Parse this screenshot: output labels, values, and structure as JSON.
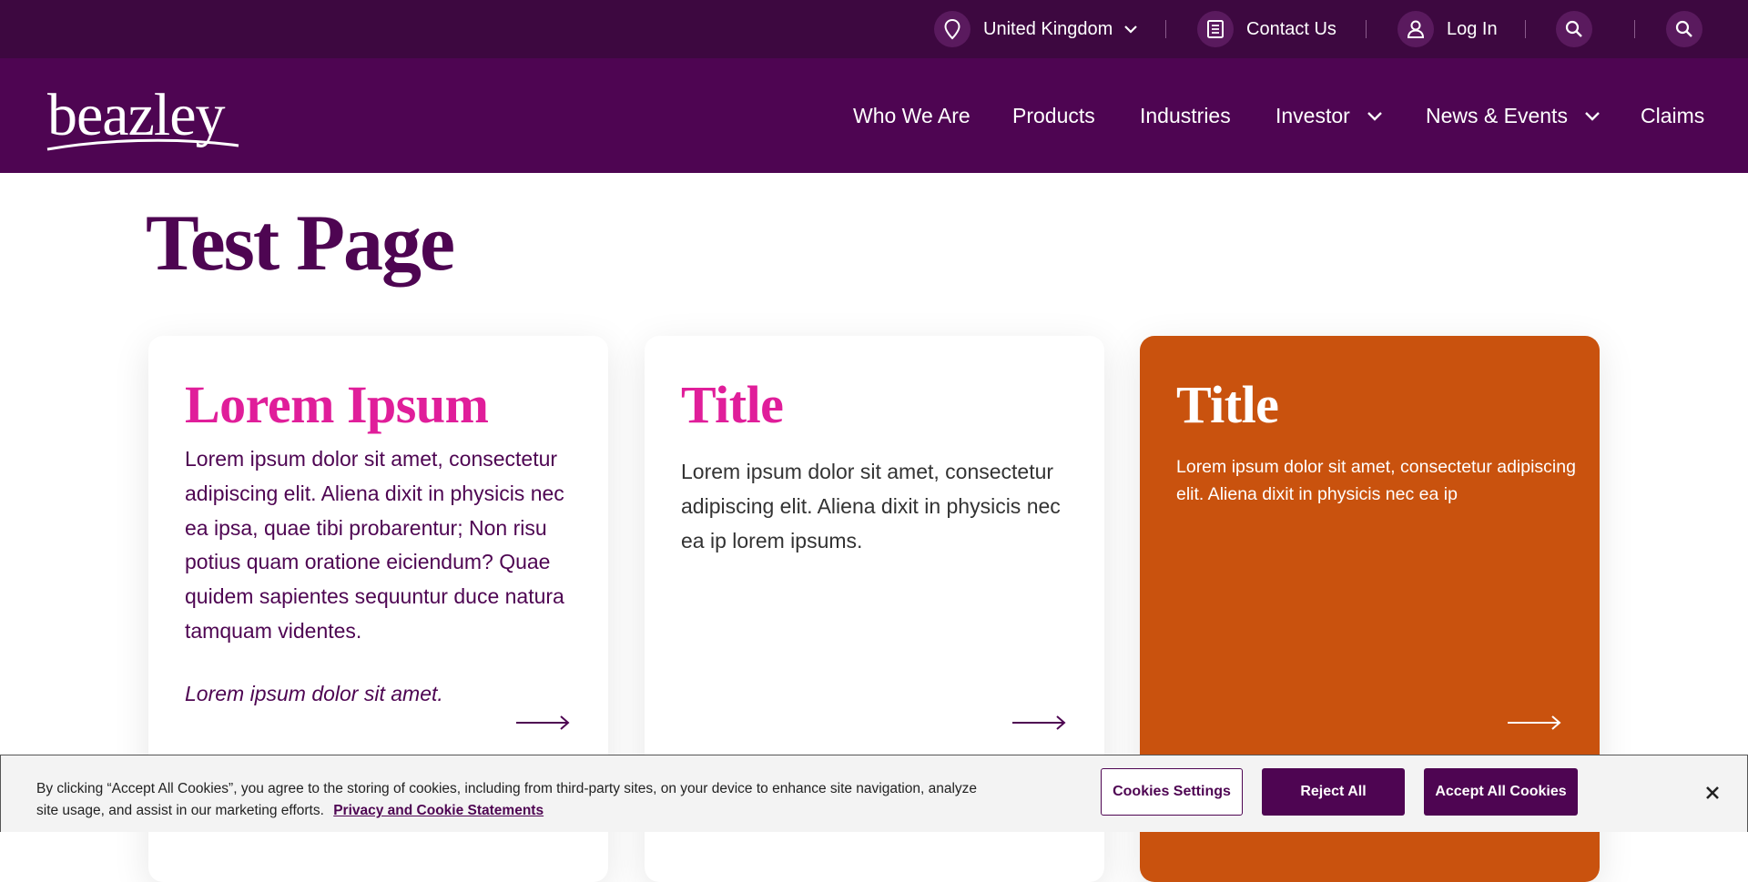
{
  "utility_bar": {
    "region_label": "United Kingdom",
    "contact_label": "Contact Us",
    "login_label": "Log In"
  },
  "header": {
    "logo_text": "beazley",
    "nav": [
      {
        "label": "Who We Are"
      },
      {
        "label": "Products"
      },
      {
        "label": "Industries"
      },
      {
        "label": "Investor"
      },
      {
        "label": "News & Events"
      },
      {
        "label": "Claims"
      }
    ]
  },
  "page": {
    "title": "Test Page"
  },
  "cards": [
    {
      "title": "Lorem Ipsum",
      "body": "Lorem ipsum dolor sit amet, consectetur adipiscing elit. Aliena dixit in physicis nec ea ipsa, quae tibi probarentur; Non risu potius quam oratione eiciendum? Quae quidem sapientes sequuntur duce natura tamquam videntes.",
      "note": "Lorem ipsum dolor sit amet."
    },
    {
      "title": "Title",
      "body": "Lorem ipsum dolor sit amet, consectetur adipiscing elit. Aliena dixit in physicis nec ea ip lorem ipsums."
    },
    {
      "title": "Title",
      "body": "Lorem ipsum dolor sit amet, consectetur adipiscing elit. Aliena dixit in physicis nec ea ip"
    }
  ],
  "cookie_banner": {
    "text": "By clicking “Accept All Cookies”, you agree to the storing of cookies, including from third-party sites, on your device to enhance site navigation, analyze site usage, and assist in our marketing efforts.",
    "link_label": "Privacy and Cookie Statements",
    "settings_label": "Cookies Settings",
    "reject_label": "Reject All",
    "accept_label": "Accept All Cookies"
  },
  "colors": {
    "utility_bg": "#3d0840",
    "nav_bg": "#4e0552",
    "title_purple": "#4e0552",
    "accent_pink": "#e01e9a",
    "card_orange": "#c9520e"
  }
}
